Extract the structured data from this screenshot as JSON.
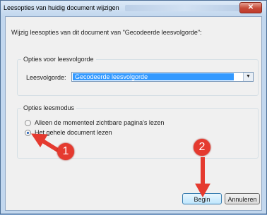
{
  "window": {
    "title": "Leesopties van huidig document wijzigen",
    "close_glyph": "✕"
  },
  "instruction": "Wijzig leesopties van dit document van \"Gecodeerde leesvolgorde\":",
  "reading_order": {
    "group_title": "Opties voor leesvolgorde",
    "label": "Leesvolgorde:",
    "selected": "Gecodeerde leesvolgorde"
  },
  "reading_mode": {
    "group_title": "Opties leesmodus",
    "options": [
      {
        "label": "Alleen de momenteel zichtbare pagina's lezen",
        "checked": false
      },
      {
        "label": "Het gehele document lezen",
        "checked": true
      }
    ]
  },
  "buttons": {
    "begin": "Begin",
    "cancel": "Annuleren"
  },
  "annotations": {
    "step1": "1",
    "step2": "2",
    "color": "#e53a2f"
  }
}
